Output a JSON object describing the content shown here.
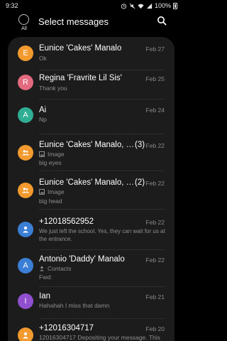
{
  "status_bar": {
    "time": "9:32",
    "battery": "100%"
  },
  "header": {
    "all_label": "All",
    "title": "Select messages"
  },
  "colors": {
    "orange": "#f29a2e",
    "pink": "#e36a7e",
    "teal": "#2fae93",
    "blue": "#3a7fd5",
    "purple": "#8f4fcf"
  },
  "conversations": [
    {
      "name": "Eunice 'Cakes' Manalo",
      "date": "Feb 27",
      "snippet": "Ok",
      "initial": "E"
    },
    {
      "name": "Regina 'Fravrite Lil Sis'",
      "date": "Feb 25",
      "snippet": "Thank you",
      "initial": "R"
    },
    {
      "name": "Ai",
      "date": "Feb 24",
      "snippet": "Np",
      "initial": "A"
    },
    {
      "name": "Eunice 'Cakes' Manalo, M…",
      "count": "(3)",
      "date": "Feb 22",
      "attachment": "Image",
      "snippet": "big eyes",
      "icon": "group-icon"
    },
    {
      "name": "Eunice 'Cakes' Manalo, M…",
      "count": "(2)",
      "date": "Feb 22",
      "attachment": "Image",
      "snippet": "big head",
      "icon": "group-icon"
    },
    {
      "name": "+12018562952",
      "date": "Feb 22",
      "snippet": "We just left the school. Yes, they can wait for us at the entrance.",
      "icon": "person-icon"
    },
    {
      "name": "Antonio 'Daddy' Manalo",
      "date": "Feb 22",
      "attachment": "Contacts",
      "snippet": "Fwd:",
      "initial": "A"
    },
    {
      "name": "Ian",
      "date": "Feb 21",
      "snippet": "Hahahah I miss that damn",
      "initial": "I"
    },
    {
      "name": "+12016304717",
      "date": "Feb 20",
      "snippet": "12016304717 Depositing your message. This",
      "icon": "person-icon"
    }
  ]
}
